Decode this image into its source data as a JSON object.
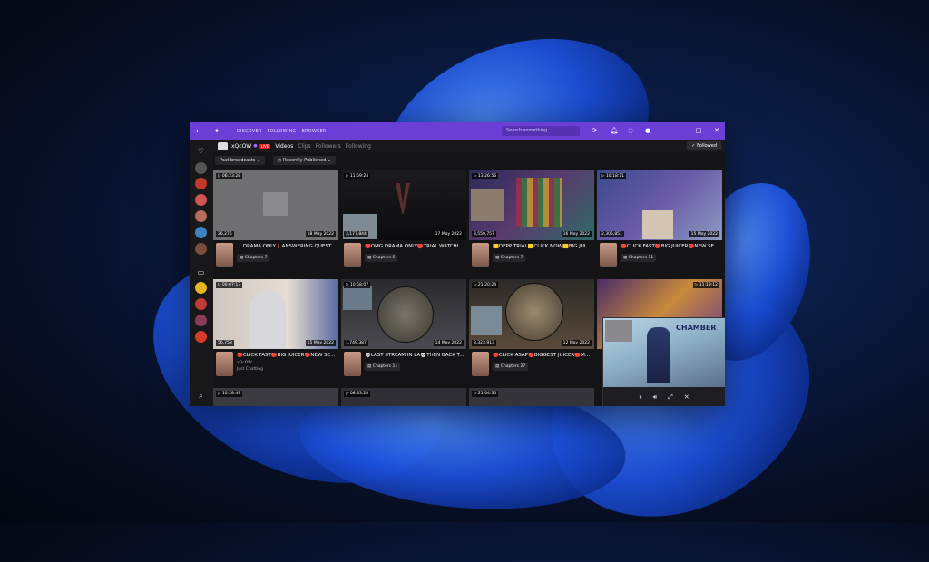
{
  "titlebar": {
    "nav": [
      "DISCOVER",
      "FOLLOWING",
      "BROWSER"
    ],
    "search_placeholder": "Search something..."
  },
  "channel": {
    "name": "xQcOW",
    "live_label": "LIVE",
    "tabs": [
      "Videos",
      "Clips",
      "Followers",
      "Following"
    ],
    "followed_label": "Followed"
  },
  "filters": {
    "type": "Past broadcasts",
    "sort": "Recently Published"
  },
  "videos": [
    {
      "duration": "06:23:28",
      "views": "26,275",
      "date": "18 May 2022",
      "title": "❗DRAMA ONLY❗ANSWERING QUEST...",
      "chapters": "Chapters",
      "chapter_count": "7"
    },
    {
      "duration": "11:59:24",
      "views": "3,177,844",
      "date": "17 May 2022",
      "title": "🛑OMG DRAMA ONLY🛑TRIAL WATCHI...",
      "chapters": "Chapters",
      "chapter_count": "5"
    },
    {
      "duration": "13:26:56",
      "views": "3,550,757",
      "date": "16 May 2022",
      "title": "🟨DEPP TRIAL🟨CLICK NOW🟨BIG JUI...",
      "chapters": "Chapters",
      "chapter_count": "7"
    },
    {
      "duration": "10:18:11",
      "views": "2,305,851",
      "date": "15 May 2022",
      "title": "🔴CLICK FAST🔴BIG JUICER🔴NEW SE...",
      "chapters": "Chapters",
      "chapter_count": "11"
    },
    {
      "duration": "00:07:13",
      "views": "56,758",
      "date": "15 May 2022",
      "title": "🔴CLICK FAST🔴BIG JUICER🔴NEW SE...",
      "channel": "xQcOW",
      "category": "Just Chatting"
    },
    {
      "duration": "10:58:07",
      "views": "1,749,387",
      "date": "14 May 2022",
      "title": "💀LAST STREAM IN LA💀THEN BACK T...",
      "chapters": "Chapters",
      "chapter_count": "11"
    },
    {
      "duration": "21:20:24",
      "views": "3,323,913",
      "date": "12 May 2022",
      "title": "🔴CLICK ASAP🔴BIGGEST JUICER🔴M...",
      "chapters": "Chapters",
      "chapter_count": "27"
    },
    {
      "duration": "11:19:12",
      "views": "",
      "date": "",
      "title": "",
      "chapters": "",
      "chapter_count": ""
    },
    {
      "duration": "10:28:49"
    },
    {
      "duration": "08:33:28"
    },
    {
      "duration": "21:04:30"
    }
  ],
  "pip": {
    "overlay_text": "CHAMBER"
  },
  "colors": {
    "accent": "#6b3fd6",
    "live": "#e91916",
    "bg": "#141417"
  }
}
